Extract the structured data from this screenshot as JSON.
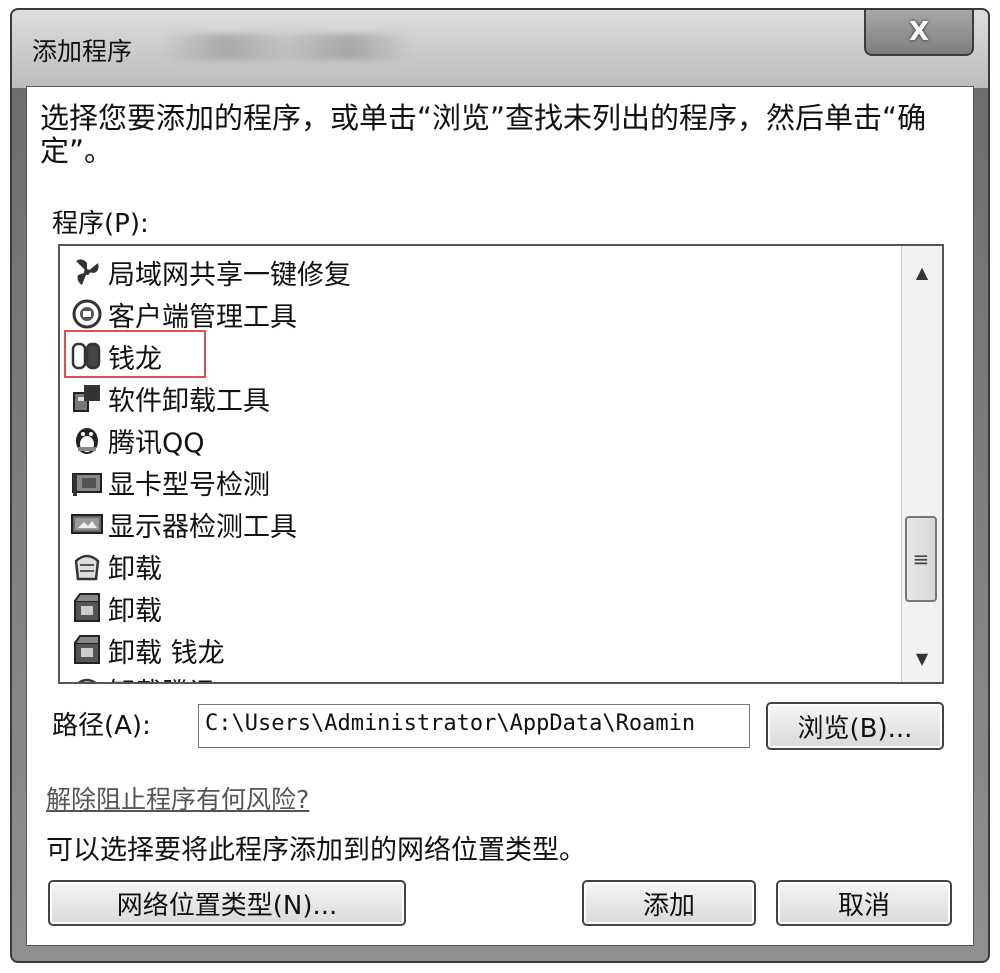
{
  "window": {
    "title": "添加程序",
    "close_label": "X"
  },
  "instruction": "选择您要添加的程序，或单击“浏览”查找未列出的程序，然后单击“确定”。",
  "programs_label": "程序(P):",
  "programs": [
    {
      "label": "局域网共享一键修复",
      "icon": "network-repair-icon"
    },
    {
      "label": "客户端管理工具",
      "icon": "client-manager-icon"
    },
    {
      "label": "钱龙",
      "icon": "qianlong-icon",
      "selected": true
    },
    {
      "label": "软件卸载工具",
      "icon": "software-uninstall-icon"
    },
    {
      "label": "腾讯QQ",
      "icon": "qq-penguin-icon"
    },
    {
      "label": "显卡型号检测",
      "icon": "graphics-card-icon"
    },
    {
      "label": "显示器检测工具",
      "icon": "monitor-icon"
    },
    {
      "label": "卸载",
      "icon": "uninstall-icon"
    },
    {
      "label": "卸载",
      "icon": "uninstall-box-icon"
    },
    {
      "label": "卸载 钱龙",
      "icon": "uninstall-box-icon"
    },
    {
      "label": "卸载腾讯QQ",
      "icon": "uninstall-icon"
    }
  ],
  "scrollbar": {
    "position": 0.62
  },
  "path_label": "路径(A):",
  "path_value": "C:\\Users\\Administrator\\AppData\\Roamin",
  "browse_button": "浏览(B)...",
  "risk_link": "解除阻止程序有何风险?",
  "network_note": "可以选择要将此程序添加到的网络位置类型。",
  "network_button": "网络位置类型(N)...",
  "add_button": "添加",
  "cancel_button": "取消"
}
